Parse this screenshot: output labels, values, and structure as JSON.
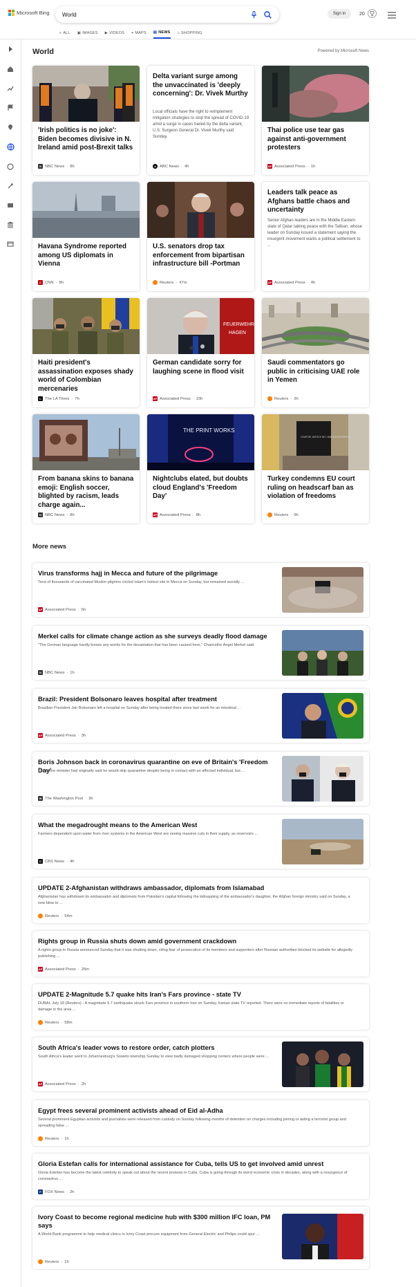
{
  "header": {
    "brand": "Microsoft Bing",
    "query": "World",
    "signin": "Sign in",
    "rewards_count": "20"
  },
  "tabs": [
    {
      "label": "ALL",
      "icon": "search-icon"
    },
    {
      "label": "IMAGES",
      "icon": "image-icon"
    },
    {
      "label": "VIDEOS",
      "icon": "video-icon"
    },
    {
      "label": "MAPS",
      "icon": "map-pin-icon"
    },
    {
      "label": "NEWS",
      "icon": "news-icon",
      "active": true
    },
    {
      "label": "SHOPPING",
      "icon": "tag-icon"
    }
  ],
  "section": {
    "title": "World",
    "powered": "Powered by Microsoft News"
  },
  "cards": [
    {
      "title": "'Irish politics is no joke': Biden becomes divisive in N. Ireland amid post-Brexit talks",
      "source": "NBC News",
      "time": "8h",
      "logo": "nbc"
    },
    {
      "title": "Delta variant surge among the unvaccinated is 'deeply concerning': Dr. Vivek Murthy",
      "desc": "Local officials have the right to reimplement mitigation strategies to stop the spread of COVID-19 amid a surge in cases fueled by the delta variant, U.S. Surgeon General Dr. Vivek Murthy said Sunday.",
      "source": "ABC News",
      "time": "4h",
      "logo": "abc"
    },
    {
      "title": "Thai police use tear gas against anti-government protesters",
      "source": "Associated Press",
      "time": "1h",
      "logo": "ap"
    },
    {
      "title": "Havana Syndrome reported among US diplomats in Vienna",
      "source": "CNN",
      "time": "8h",
      "logo": "cnn"
    },
    {
      "title": "U.S. senators drop tax enforcement from bipartisan infrastructure bill -Portman",
      "source": "Reuters",
      "time": "47m",
      "logo": "reuters"
    },
    {
      "title": "Leaders talk peace as Afghans battle chaos and uncertainty",
      "desc": "Senior Afghan leaders are in the Middle Eastern state of Qatar talking peace with the Taliban, whose leader on Sunday issued a statement saying the insurgent movement wants a political settlement to ...",
      "source": "Associated Press",
      "time": "4h",
      "logo": "ap"
    },
    {
      "title": "Haiti president's assassination exposes shady world of Colombian mercenaries",
      "source": "The LA Times",
      "time": "7h",
      "logo": "lat"
    },
    {
      "title": "German candidate sorry for laughing scene in flood visit",
      "source": "Associated Press",
      "time": "10h",
      "logo": "ap"
    },
    {
      "title": "Saudi commentators go public in criticising UAE role in Yemen",
      "source": "Reuters",
      "time": "3h",
      "logo": "reuters"
    },
    {
      "title": "From banana skins to banana emoji: English soccer, blighted by racism, leads charge again...",
      "source": "NBC News",
      "time": "8h",
      "logo": "nbc"
    },
    {
      "title": "Nightclubs elated, but doubts cloud England's 'Freedom Day'",
      "source": "Associated Press",
      "time": "8h",
      "logo": "ap"
    },
    {
      "title": "Turkey condemns EU court ruling on headscarf ban as violation of freedoms",
      "source": "Reuters",
      "time": "9h",
      "logo": "reuters"
    }
  ],
  "image_text": {
    "fire_sign_1": "FEUERWEHR",
    "fire_sign_2": "HAGEN",
    "club_sign": "THE PRINT WORKS",
    "court_sign": "COUR DE JUSTICE DE L'UNION EUROPÉENNE"
  },
  "more_news": {
    "title": "More news",
    "items": [
      {
        "title": "Virus transforms hajj in Mecca and future of the pilgrimage",
        "desc": "Tens of thousands of vaccinated Muslim pilgrims circled Islam's holiest site in Mecca on Sunday, but remained socially ...",
        "source": "Associated Press",
        "time": "5h",
        "logo": "ap"
      },
      {
        "title": "Merkel calls for climate change action as she surveys deadly flood damage",
        "desc": "\"The German language hardly knows any words for the devastation that has been caused here,\" Chancellor Angel Merkel said.",
        "source": "NBC News",
        "time": "1h",
        "logo": "nbc"
      },
      {
        "title": "Brazil: President Bolsonaro leaves hospital after treatment",
        "desc": "Brazilian President Jair Bolsonaro left a hospital on Sunday after being treated there since last week for an intestinal ...",
        "source": "Associated Press",
        "time": "3h",
        "logo": "ap"
      },
      {
        "title": "Boris Johnson back in coronavirus quarantine on eve of Britain's 'Freedom Day'",
        "desc": "The prime minister had originally said he would skip quarantine despite being in contact with an affected individual, but ...",
        "source": "The Washington Post",
        "time": "3h",
        "logo": "wp"
      },
      {
        "title": "What the megadrought means to the American West",
        "desc": "Farmers dependent upon water from river systems in the American West are seeing massive cuts in their supply, as reservoirs ...",
        "source": "CBS News",
        "time": "4h",
        "logo": "cbs"
      },
      {
        "title": "UPDATE 2-Afghanistan withdraws ambassador, diplomats from Islamabad",
        "desc": "Afghanistan has withdrawn its ambassador and diplomats from Pakistan's capital following the kidnapping of the ambassador's daughter, the Afghan foreign ministry said on Sunday, a new blow to ...",
        "source": "Reuters",
        "time": "54m",
        "logo": "reuters"
      },
      {
        "title": "Rights group in Russia shuts down amid government crackdown",
        "desc": "A rights group in Russia announced Sunday that it was shutting down, citing fear of prosecution of its members and supporters after Russian authorities blocked its website for allegedly publishing ...",
        "source": "Associated Press",
        "time": "26m",
        "logo": "ap"
      },
      {
        "title": "UPDATE 2-Magnitude 5.7 quake hits Iran's Fars province - state TV",
        "desc": "DUBAI, July 18 (Reuters) - A magnitude 5.7 earthquake struck Fars province in southern Iran on Sunday, Iranian state TV reported. There were no immediate reports of fatalities or damage in the area ...",
        "source": "Reuters",
        "time": "58m",
        "logo": "reuters"
      },
      {
        "title": "South Africa's leader vows to restore order, catch plotters",
        "desc": "South Africa's leader went to Johannesburg's Soweto township Sunday to view badly damaged shopping centers where people were ...",
        "source": "Associated Press",
        "time": "2h",
        "logo": "ap"
      },
      {
        "title": "Egypt frees several prominent activists ahead of Eid al-Adha",
        "desc": "Several prominent Egyptian activists and journalists were released from custody on Sunday following months of detention on charges including joining or aiding a terrorist group and spreading false ...",
        "source": "Reuters",
        "time": "1h",
        "logo": "reuters"
      },
      {
        "title": "Gloria Estefan calls for international assistance for Cuba, tells US to get involved amid unrest",
        "desc": "Gloria Estefan has become the latest celebrity to speak out about the recent protests in Cuba.  Cuba is going through its worst economic crisis in decades, along with a resurgence of coronavirus ...",
        "source": "FOX News",
        "time": "2h",
        "logo": "fox"
      },
      {
        "title": "Ivory Coast to become regional medicine hub with $300 million IFC loan, PM says",
        "desc": "A World Bank programme to help medical clinics in Ivory Coast procure equipment from General Electric and Philips could spur ...",
        "source": "Reuters",
        "time": "1h",
        "logo": "reuters"
      }
    ]
  },
  "footer": {
    "text": ""
  },
  "colors": {
    "accent": "#174ae4",
    "ap": "#d0021b",
    "reuters": "#ff8000",
    "cnn": "#cc0000"
  }
}
